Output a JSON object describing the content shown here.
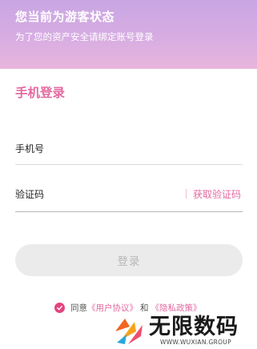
{
  "banner": {
    "title": "您当前为游客状态",
    "subtitle": "为了您的资产安全请绑定账号登录"
  },
  "login": {
    "section_title": "手机登录",
    "phone_label": "手机号",
    "phone_value": "",
    "code_label": "验证码",
    "code_value": "",
    "get_code_label": "获取验证码",
    "submit_label": "登录"
  },
  "agreement": {
    "checked": true,
    "prefix": "同意",
    "user_agreement": "《用户协议》",
    "and": "和",
    "privacy_policy": "《隐私政策》"
  },
  "watermark": {
    "brand": "无限数码",
    "url": "WWW.WUXIAN.GROUP"
  },
  "colors": {
    "accent": "#e36aa0",
    "check": "#e3457f",
    "banner_start": "#c9a6e3",
    "banner_end": "#e8b5dc",
    "button_disabled": "#ebebeb"
  }
}
